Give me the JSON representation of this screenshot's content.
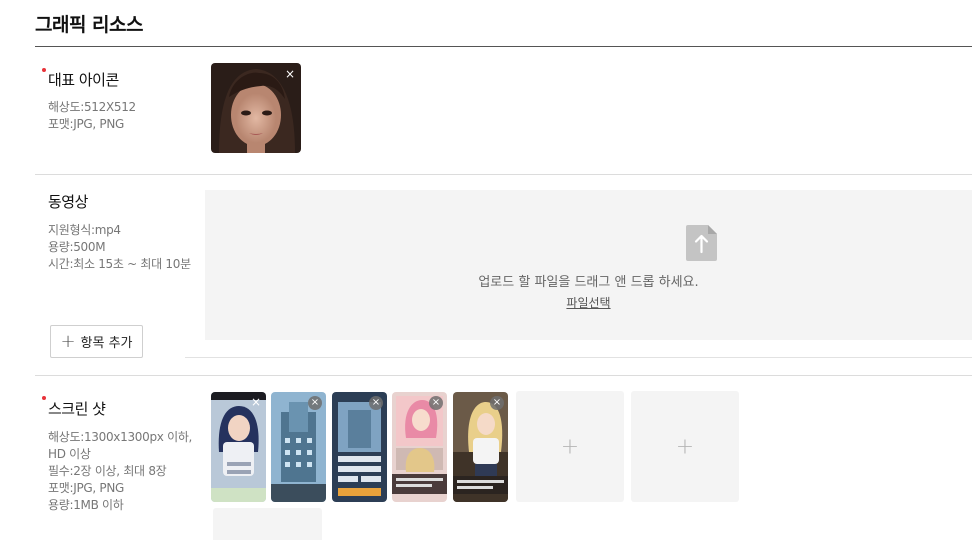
{
  "section": {
    "title": "그래픽 리소스"
  },
  "icon_row": {
    "label": "대표 아이콘",
    "required": true,
    "info": [
      "해상도:512X512",
      "포맷:JPG, PNG"
    ],
    "close_glyph": "×"
  },
  "video_row": {
    "label": "동영상",
    "required": false,
    "info": [
      "지원형식:mp4",
      "용량:500M",
      "시간:최소 15초 ~ 최대 10분"
    ],
    "dropzone_text": "업로드 할 파일을 드래그 앤 드롭 하세요.",
    "file_select_label": "파일선택",
    "file_icon": "file-upload-icon",
    "add_item_label": "항목 추가",
    "add_glyph": "+"
  },
  "screenshot_row": {
    "label": "스크린 샷",
    "required": true,
    "info": [
      "해상도:1300x1300px 이하,",
      "HD 이상",
      "필수:2장 이상, 최대 8장",
      "포맷:JPG, PNG",
      "용량:1MB 이하"
    ],
    "thumbnail_count": 5,
    "close_glyph": "×",
    "empty_slot_glyph": "+"
  },
  "colors": {
    "required_dot": "#e8333a",
    "dropzone_bg": "#f4f4f4",
    "slot_bg": "#f4f4f4"
  }
}
